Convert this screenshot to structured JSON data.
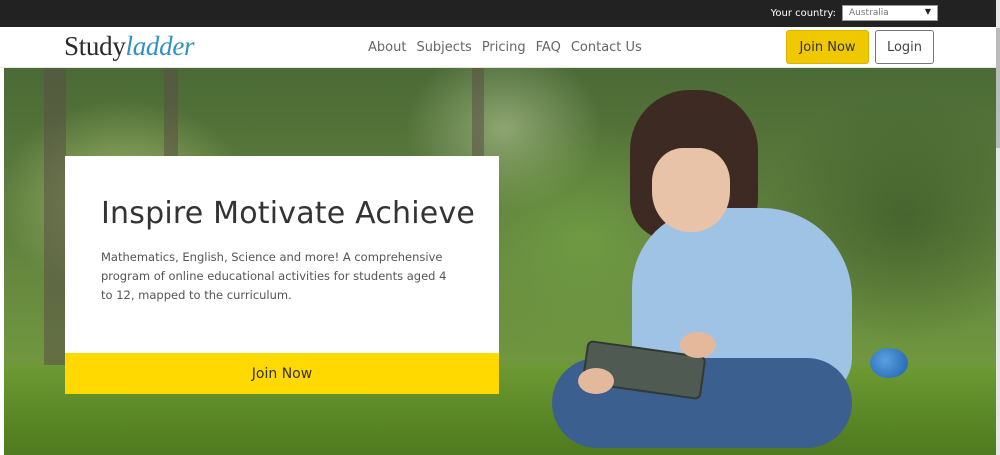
{
  "topbar": {
    "country_label": "Your country:",
    "country_value": "Australia"
  },
  "header": {
    "logo_study": "Study",
    "logo_ladder": "ladder",
    "nav": [
      "About",
      "Subjects",
      "Pricing",
      "FAQ",
      "Contact Us"
    ],
    "join_label": "Join Now",
    "login_label": "Login"
  },
  "hero": {
    "title": "Inspire Motivate Achieve",
    "description": "Mathematics, English, Science and more! A comprehensive program of online educational activities for students aged 4 to 12, mapped to the curriculum.",
    "cta_label": "Join Now"
  },
  "colors": {
    "accent": "#ffd900",
    "brand_blue": "#2f8fc7",
    "topbar": "#222222"
  }
}
